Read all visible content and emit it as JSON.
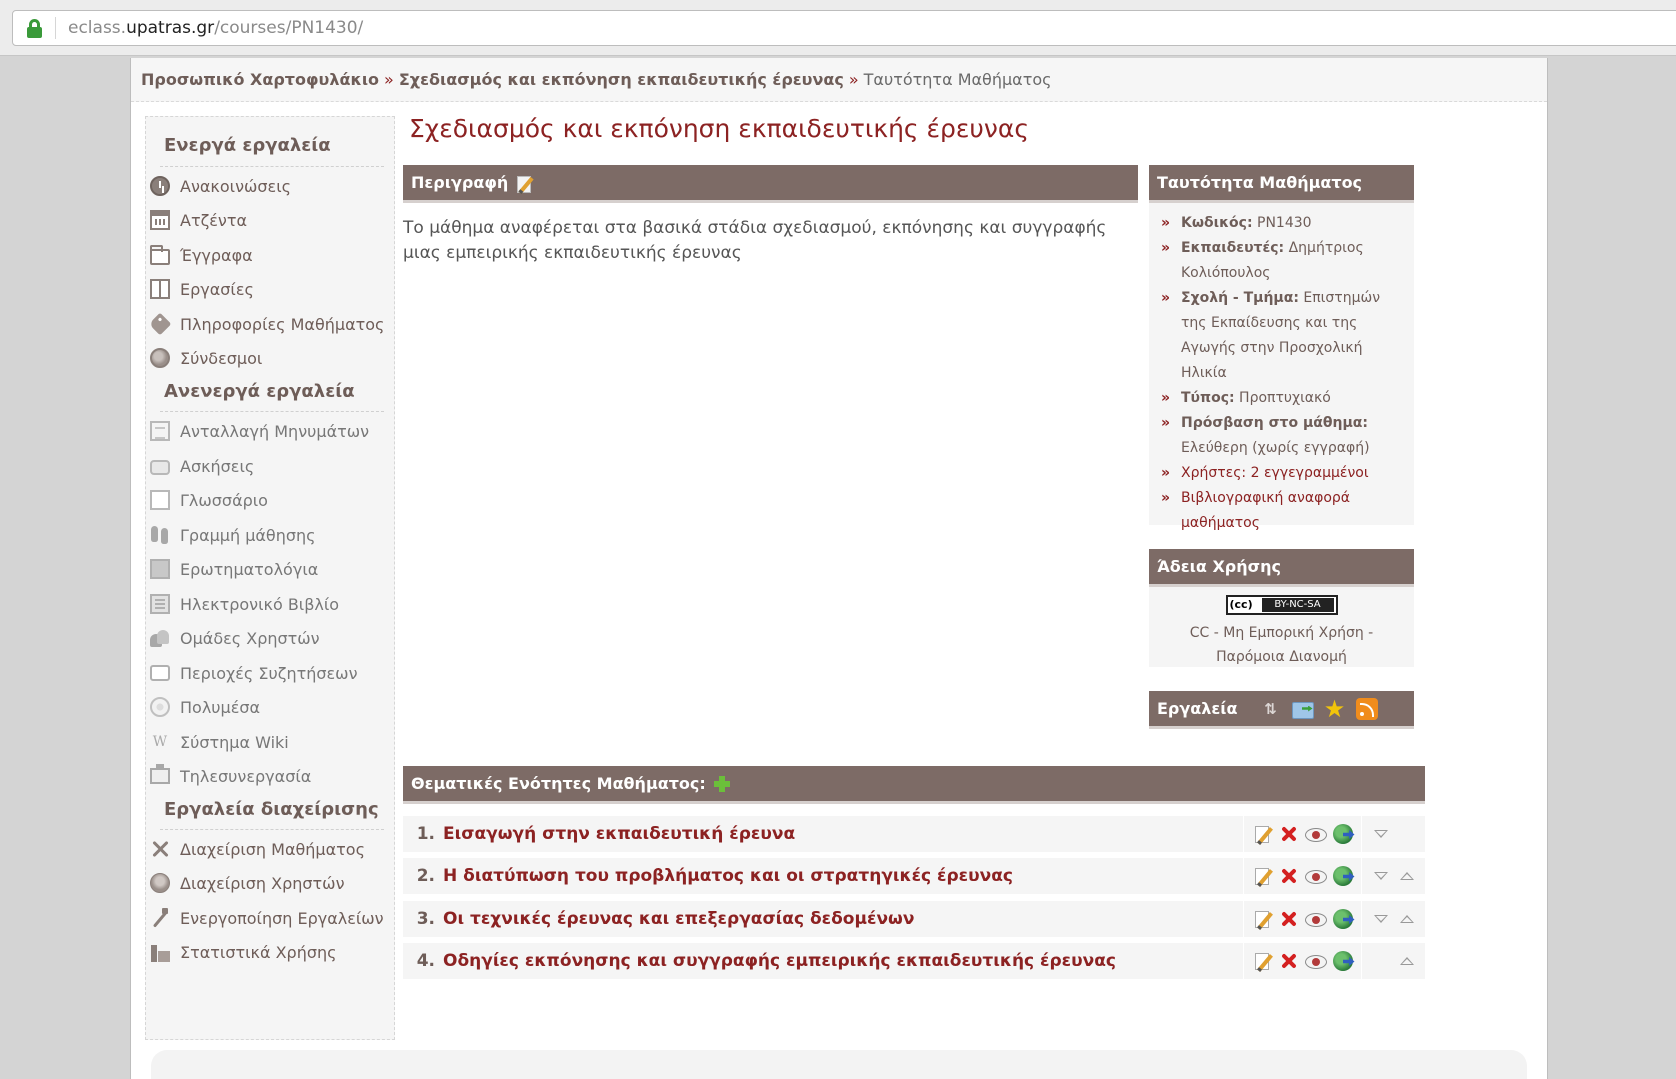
{
  "browser": {
    "url_prefix": "eclass.",
    "url_domain": "upatras.gr",
    "url_path": "/courses/PN1430/"
  },
  "breadcrumb": {
    "portfolio": "Προσωπικό Χαρτοφυλάκιο",
    "course": "Σχεδιασμός και εκπόνηση εκπαιδευτικής έρευνας",
    "current": "Ταυτότητα Μαθήματος",
    "separator": "»"
  },
  "sidebar": {
    "active_title": "Ενεργά εργαλεία",
    "active_tools": [
      {
        "label": "Ανακοινώσεις",
        "icon": "clock-icon"
      },
      {
        "label": "Ατζέντα",
        "icon": "calendar-icon"
      },
      {
        "label": "Έγγραφα",
        "icon": "folder-icon"
      },
      {
        "label": "Εργασίες",
        "icon": "book-icon"
      },
      {
        "label": "Πληροφορίες Μαθήματος",
        "icon": "tag-icon"
      },
      {
        "label": "Σύνδεσμοι",
        "icon": "globe-icon"
      }
    ],
    "inactive_title": "Ανενεργά εργαλεία",
    "inactive_tools": [
      {
        "label": "Ανταλλαγή Μηνυμάτων",
        "icon": "document-icon"
      },
      {
        "label": "Ασκήσεις",
        "icon": "speech-bubble-icon"
      },
      {
        "label": "Γλωσσάριο",
        "icon": "glossary-icon"
      },
      {
        "label": "Γραμμή μάθησης",
        "icon": "footprints-icon"
      },
      {
        "label": "Ερωτηματολόγια",
        "icon": "questionnaire-icon"
      },
      {
        "label": "Ηλεκτρονικό Βιβλίο",
        "icon": "ebook-icon"
      },
      {
        "label": "Ομάδες Χρηστών",
        "icon": "group-icon"
      },
      {
        "label": "Περιοχές Συζητήσεων",
        "icon": "forum-icon"
      },
      {
        "label": "Πολυμέσα",
        "icon": "media-icon"
      },
      {
        "label": "Σύστημα Wiki",
        "icon": "wiki-icon",
        "glyph": "W"
      },
      {
        "label": "Τηλεσυνεργασία",
        "icon": "teleconference-icon"
      }
    ],
    "admin_title": "Εργαλεία διαχείρισης",
    "admin_tools": [
      {
        "label": "Διαχείριση Μαθήματος",
        "icon": "tools-icon"
      },
      {
        "label": "Διαχείριση Χρηστών",
        "icon": "users-icon"
      },
      {
        "label": "Ενεργοποίηση Εργαλείων",
        "icon": "wand-icon"
      },
      {
        "label": "Στατιστικά Χρήσης",
        "icon": "stats-icon"
      }
    ]
  },
  "course": {
    "title": "Σχεδιασμός και εκπόνηση εκπαιδευτικής έρευνας",
    "description_header": "Περιγραφή",
    "description": "Το μάθημα αναφέρεται στα βασικά στάδια σχεδιασμού, εκπόνησης και συγγραφής μιας εμπειρικής εκπαιδευτικής έρευνας"
  },
  "identity": {
    "header": "Ταυτότητα Μαθήματος",
    "code_label": "Κωδικός:",
    "code": "PN1430",
    "instructor_label": "Εκπαιδευτές:",
    "instructor": "Δημήτριος Κολιόπουλος",
    "faculty_label": "Σχολή - Τμήμα:",
    "faculty": "Επιστημών της Εκπαίδευσης και της Αγωγής στην Προσχολική Ηλικία",
    "type_label": "Τύπος:",
    "type": "Προπτυχιακό",
    "access_label": "Πρόσβαση στο μάθημα:",
    "access": "Ελεύθερη (χωρίς εγγραφή)",
    "users_label": "Χρήστες:",
    "users": "2 εγγεγραμμένοι",
    "bibliography": "Βιβλιογραφική αναφορά μαθήματος",
    "bullet": "»"
  },
  "license": {
    "header": "Άδεια Χρήσης",
    "badge_cc": "(cc)",
    "badge_text": "BY-NC-SA",
    "text": "CC - Μη Εμπορική Χρήση - Παρόμοια Διανομή"
  },
  "tools_panel": {
    "header": "Εργαλεία",
    "icons": [
      "move-arrows-icon",
      "email-icon",
      "favorite-star-icon",
      "rss-icon"
    ],
    "arrows_glyph": "⇅"
  },
  "units": {
    "header": "Θεματικές Ενότητες Μαθήματος:",
    "items": [
      {
        "num": "1.",
        "title": "Εισαγωγή στην εκπαιδευτική έρευνα"
      },
      {
        "num": "2.",
        "title": "Η διατύπωση του προβλήματος και οι στρατηγικές έρευνας"
      },
      {
        "num": "3.",
        "title": "Οι τεχνικές έρευνας και επεξεργασίας δεδομένων"
      },
      {
        "num": "4.",
        "title": "Οδηγίες εκπόνησης και συγγραφής εμπειρικής εκπαιδευτικής έρευνας"
      }
    ]
  },
  "colors": {
    "accent": "#8c2222",
    "header_bg": "#7d6b66",
    "link": "#6e5d58"
  }
}
